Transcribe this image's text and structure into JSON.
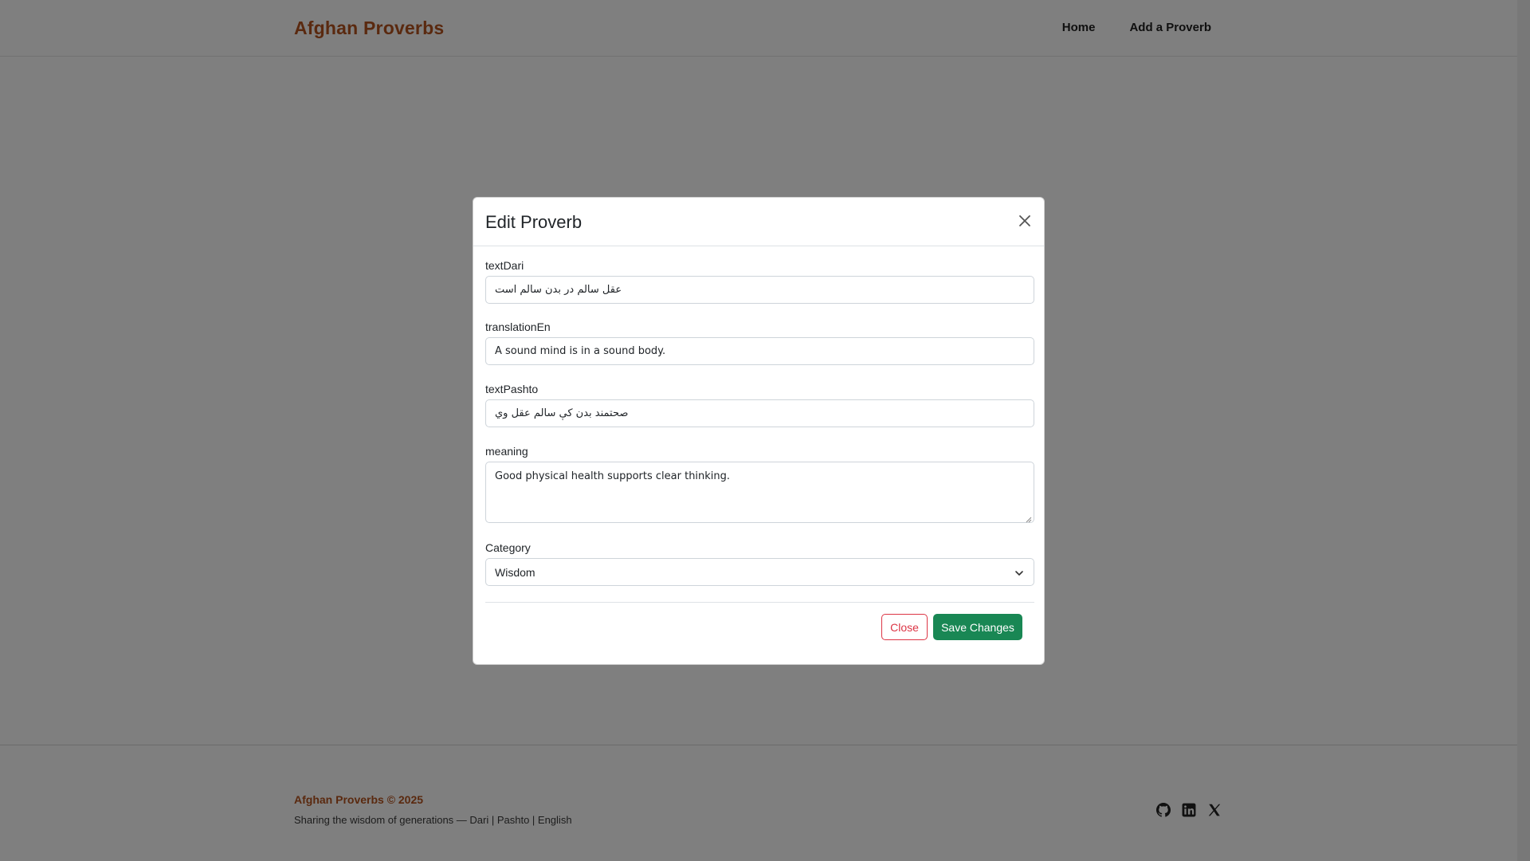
{
  "nav": {
    "brand": "Afghan Proverbs",
    "links": [
      "Home",
      "Add a Proverb"
    ]
  },
  "footer": {
    "title": "Afghan Proverbs © 2025",
    "tagline": "Sharing the wisdom of generations — Dari | Pashto | English",
    "social_icons": [
      "github-icon",
      "linkedin-icon",
      "x-icon"
    ]
  },
  "modal": {
    "title": "Edit Proverb",
    "fields": [
      {
        "label": "textDari",
        "value": "عقل سالم در بدن سالم است"
      },
      {
        "label": "translationEn",
        "value": "A sound mind is in a sound body."
      },
      {
        "label": "textPashto",
        "value": "صحتمند بدن کې سالم عقل وي"
      },
      {
        "label": "meaning",
        "value": "Good physical health supports clear thinking."
      },
      {
        "label": "Category",
        "value": "Wisdom"
      }
    ],
    "close_label": "Close",
    "save_label": "Save Changes"
  },
  "colors": {
    "brand": "#b5531e",
    "danger": "#dc3545",
    "success": "#198754"
  }
}
